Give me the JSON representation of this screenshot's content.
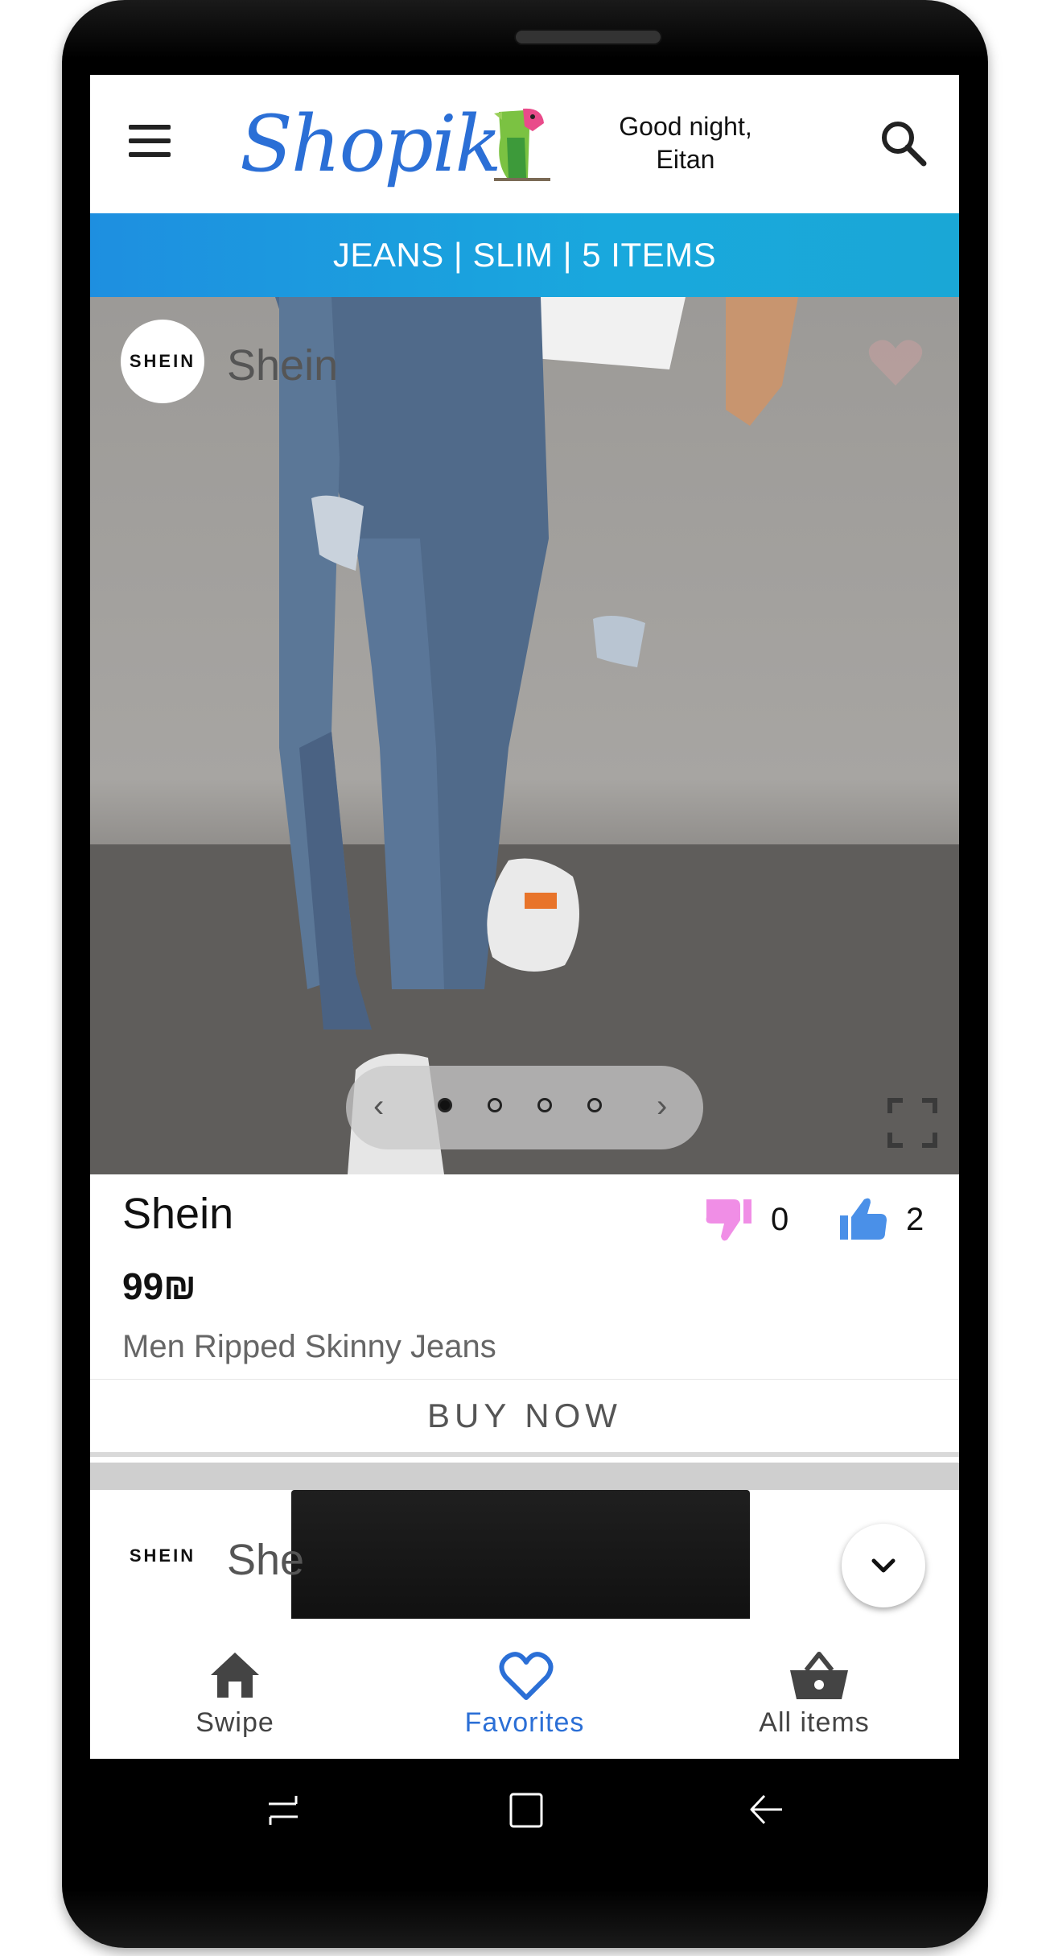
{
  "header": {
    "logo_text": "Shopik",
    "greeting_line1": "Good night,",
    "greeting_line2": "Eitan"
  },
  "category_bar": {
    "label": "JEANS | SLIM | 5 ITEMS"
  },
  "product": {
    "shop_badge": "SHEIN",
    "shop_name": "Shein",
    "brand": "Shein",
    "price": "99₪",
    "description": "Men Ripped Skinny Jeans",
    "dislikes": "0",
    "likes": "2",
    "carousel": {
      "pages": 4,
      "current": 1
    },
    "buy_label": "BUY NOW"
  },
  "next_product": {
    "shop_badge": "SHEIN",
    "shop_name": "She"
  },
  "bottom_nav": {
    "items": [
      {
        "label": "Swipe",
        "icon": "home-icon",
        "active": false
      },
      {
        "label": "Favorites",
        "icon": "heart-icon",
        "active": true
      },
      {
        "label": "All items",
        "icon": "basket-icon",
        "active": false
      }
    ]
  },
  "colors": {
    "brand_blue": "#2b6fd6",
    "category_bar": "#1aa7d6",
    "dislike_pink": "#f08ee6",
    "like_blue": "#4a90e8",
    "nav_active": "#2b6fd6",
    "nav_inactive": "#444444"
  }
}
